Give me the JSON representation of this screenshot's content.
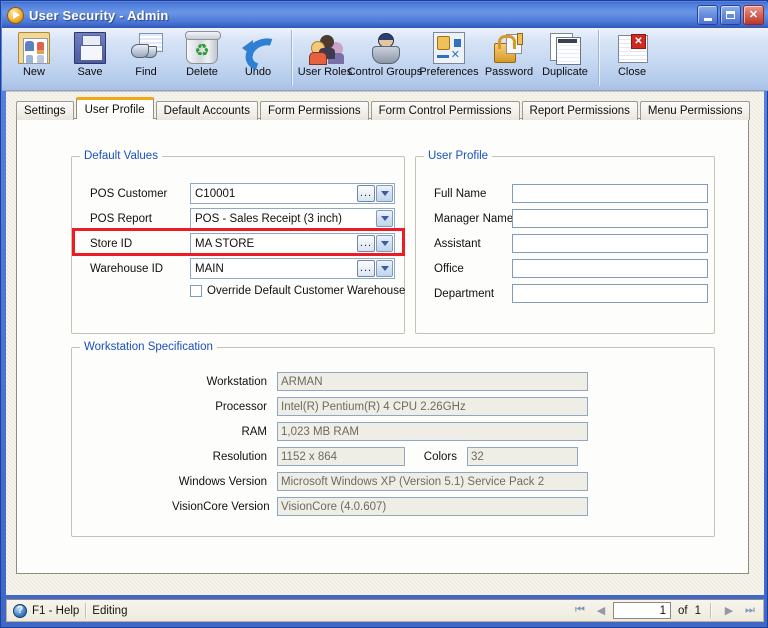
{
  "window": {
    "title": "User Security - Admin",
    "title_icon": "play-circle-icon",
    "buttons": {
      "minimize": "minimize-icon",
      "maximize": "maximize-icon",
      "close": "close-icon"
    },
    "accent_title_blue": "#4a76d6",
    "accent_tab_orange": "#f0a818",
    "highlight_red": "#ec1c24",
    "group_title_blue": "#1a4fbe"
  },
  "toolbar": {
    "groups": [
      {
        "items": [
          {
            "label": "New",
            "icon": "new-document-icon"
          },
          {
            "label": "Save",
            "icon": "floppy-disk-icon"
          },
          {
            "label": "Find",
            "icon": "binoculars-icon"
          },
          {
            "label": "Delete",
            "icon": "recycle-bin-icon"
          },
          {
            "label": "Undo",
            "icon": "undo-arrow-icon"
          }
        ]
      },
      {
        "items": [
          {
            "label": "User Roles",
            "icon": "users-group-icon"
          },
          {
            "label": "Control Groups",
            "icon": "user-computer-icon"
          },
          {
            "label": "Preferences",
            "icon": "preferences-icon"
          },
          {
            "label": "Password",
            "icon": "padlock-key-icon"
          },
          {
            "label": "Duplicate",
            "icon": "duplicate-pages-icon"
          }
        ]
      },
      {
        "items": [
          {
            "label": "Close",
            "icon": "close-document-icon"
          }
        ]
      }
    ]
  },
  "tabs": [
    {
      "label": "Settings",
      "active": false
    },
    {
      "label": "User Profile",
      "active": true
    },
    {
      "label": "Default Accounts",
      "active": false
    },
    {
      "label": "Form Permissions",
      "active": false
    },
    {
      "label": "Form Control Permissions",
      "active": false
    },
    {
      "label": "Report Permissions",
      "active": false
    },
    {
      "label": "Menu Permissions",
      "active": false
    }
  ],
  "default_values": {
    "title": "Default Values",
    "pos_customer": {
      "label": "POS Customer",
      "value": "C10001",
      "has_ellipsis": true,
      "ellipsis_label": "..."
    },
    "pos_report": {
      "label": "POS Report",
      "value": "POS - Sales Receipt (3 inch)",
      "has_ellipsis": false
    },
    "store_id": {
      "label": "Store ID",
      "value": "MA STORE",
      "has_ellipsis": true,
      "ellipsis_label": "...",
      "highlighted": true
    },
    "warehouse_id": {
      "label": "Warehouse ID",
      "value": "MAIN",
      "has_ellipsis": true,
      "ellipsis_label": "..."
    },
    "override_checkbox": {
      "label": "Override Default Customer Warehouse",
      "checked": false
    }
  },
  "user_profile": {
    "title": "User Profile",
    "fields": [
      {
        "label": "Full Name",
        "value": "",
        "placeholder": ""
      },
      {
        "label": "Manager Name",
        "value": "",
        "placeholder": ""
      },
      {
        "label": "Assistant",
        "value": "",
        "placeholder": ""
      },
      {
        "label": "Office",
        "value": "",
        "placeholder": ""
      },
      {
        "label": "Department",
        "value": "",
        "placeholder": ""
      }
    ]
  },
  "workstation": {
    "title": "Workstation Specification",
    "fields": [
      {
        "label": "Workstation",
        "value": "ARMAN"
      },
      {
        "label": "Processor",
        "value": "Intel(R) Pentium(R) 4 CPU 2.26GHz"
      },
      {
        "label": "RAM",
        "value": "1,023 MB RAM"
      },
      {
        "label": "Resolution",
        "value": "1152 x 864"
      },
      {
        "label": "Windows Version",
        "value": "Microsoft Windows XP (Version 5.1) Service Pack 2"
      },
      {
        "label": "VisionCore Version",
        "value": "VisionCore (4.0.607)"
      }
    ],
    "colors": {
      "label": "Colors",
      "value": "32"
    }
  },
  "statusbar": {
    "help": "F1 - Help",
    "help_icon": "question-mark-icon",
    "mode": "Editing",
    "pager": {
      "first": "first-page-icon",
      "prev": "previous-page-icon",
      "current": "1",
      "of": "of",
      "total": "1",
      "next": "next-page-icon",
      "last": "last-page-icon"
    }
  }
}
